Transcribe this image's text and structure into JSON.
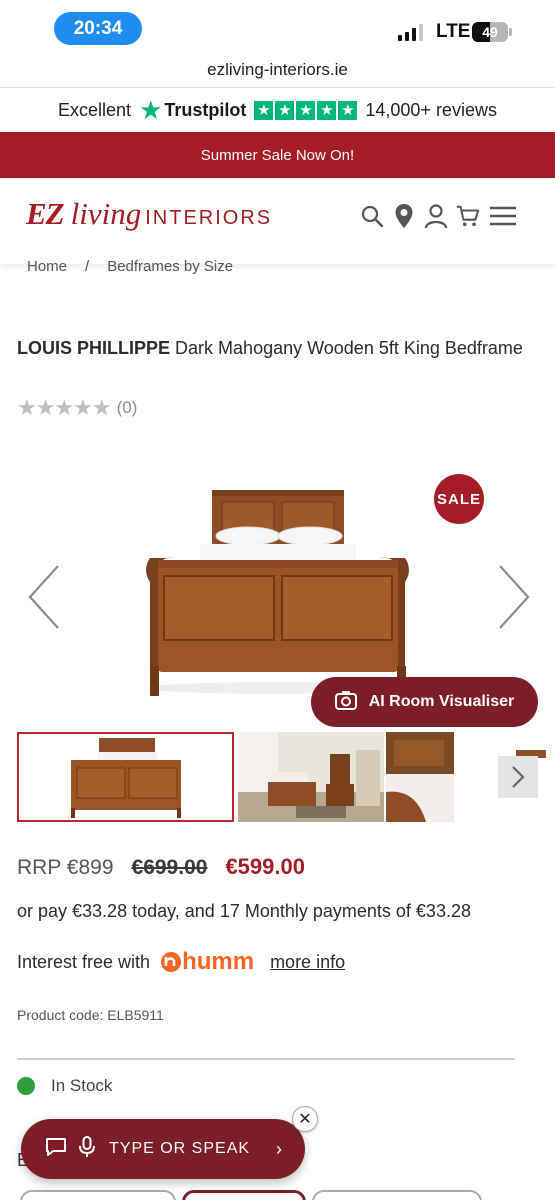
{
  "status_bar": {
    "time": "20:34",
    "network": "LTE",
    "battery": "49",
    "battery_level": 0.49
  },
  "browser": {
    "url": "ezliving-interiors.ie"
  },
  "trustpilot": {
    "rating_word": "Excellent",
    "brand": "Trustpilot",
    "reviews": "14,000+ reviews",
    "star_color": "#00b67a"
  },
  "banner": {
    "text": "Summer Sale Now On!",
    "color": "#a51c24"
  },
  "header": {
    "logo_ez": "EZ",
    "logo_living": "living",
    "logo_interiors": "INTERIORS",
    "icons": [
      "search-icon",
      "location-icon",
      "account-icon",
      "cart-icon",
      "menu-icon"
    ]
  },
  "breadcrumb": {
    "items": [
      "Home",
      "/",
      "Bedframes by Size"
    ]
  },
  "product": {
    "brand": "LOUIS PHILLIPPE",
    "title": "Dark Mahogany Wooden 5ft King Bedframe",
    "rating_count": "(0)",
    "rating_value": 0,
    "sale_badge": "SALE",
    "visualiser_label": "AI Room Visualiser",
    "rrp": "RRP €899",
    "old_price": "€699.00",
    "price": "€599.00",
    "finance_text": "or pay €33.28 today, and 17 Monthly payments of €33.28",
    "interest_text": "Interest free with",
    "humm_logo": "humm",
    "more_info": "more info",
    "product_code": "Product code: ELB5911",
    "stock": "In Stock",
    "stock_color": "#2e9e3a"
  },
  "chat": {
    "label": "TYPE OR SPEAK",
    "close": "✕",
    "chevron": "›"
  },
  "bottom": {
    "partial_letter": "E"
  }
}
